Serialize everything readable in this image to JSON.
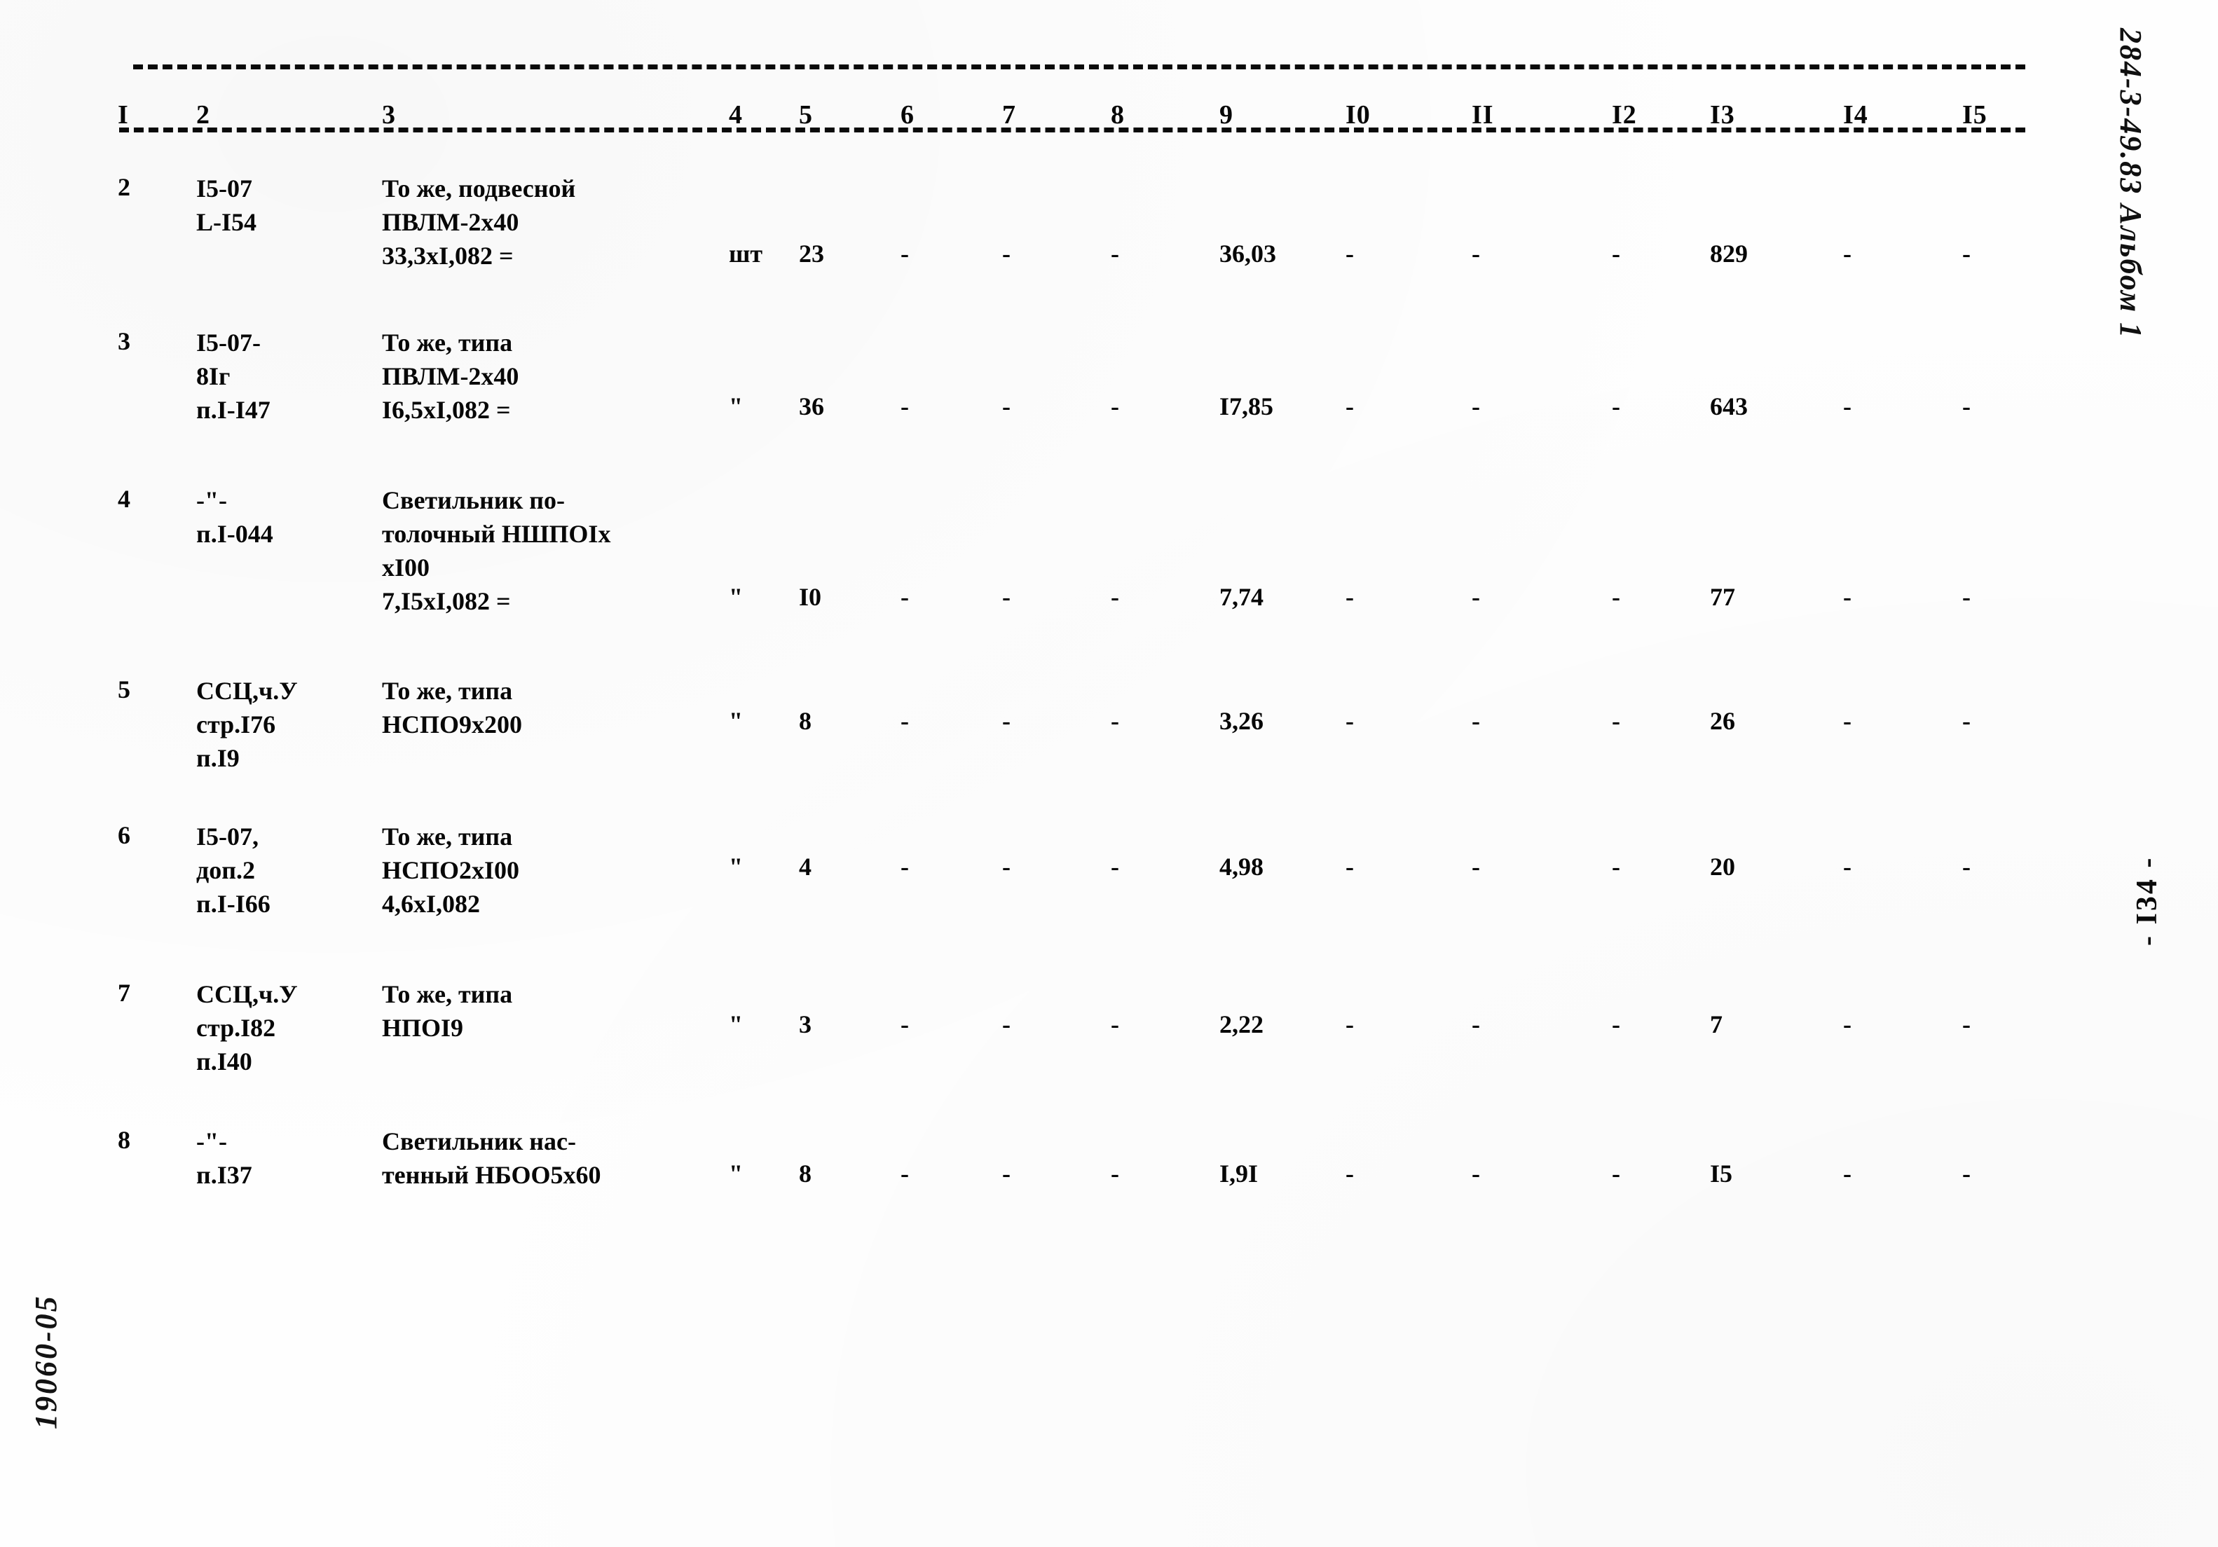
{
  "document": {
    "margin_code": "284-3-49.83 Альбом 1",
    "page_number": "- I34 -",
    "archive_stamp": "19060-05"
  },
  "table": {
    "column_headers": [
      "I",
      "2",
      "3",
      "4",
      "5",
      "6",
      "7",
      "8",
      "9",
      "I0",
      "II",
      "I2",
      "I3",
      "I4",
      "I5"
    ],
    "rows": [
      {
        "no": "2",
        "code": "I5-07\nL-I54",
        "name": "То же, подвесной\nПВЛМ-2х40\n33,3хI,082 =",
        "unit": "шт",
        "qty": "23",
        "c6": "-",
        "c7": "-",
        "c8": "-",
        "c9": "36,03",
        "c10": "-",
        "c11": "-",
        "c12": "-",
        "c13": "829",
        "c14": "-",
        "c15": "-"
      },
      {
        "no": "3",
        "code": "I5-07-\n8Iг\nп.I-I47",
        "name": "То же, типа\nПВЛМ-2х40\nI6,5хI,082 =",
        "unit": "\"",
        "qty": "36",
        "c6": "-",
        "c7": "-",
        "c8": "-",
        "c9": "I7,85",
        "c10": "-",
        "c11": "-",
        "c12": "-",
        "c13": "643",
        "c14": "-",
        "c15": "-"
      },
      {
        "no": "4",
        "code": "-\"-\nп.I-044",
        "name": "Светильник по-\nтолочный НШПОIх\nхI00\n7,I5хI,082 =",
        "unit": "\"",
        "qty": "I0",
        "c6": "-",
        "c7": "-",
        "c8": "-",
        "c9": "7,74",
        "c10": "-",
        "c11": "-",
        "c12": "-",
        "c13": "77",
        "c14": "-",
        "c15": "-"
      },
      {
        "no": "5",
        "code": "ССЦ,ч.У\nстр.I76\nп.I9",
        "name": "То же, типа\nНСПО9х200",
        "unit": "\"",
        "qty": "8",
        "c6": "-",
        "c7": "-",
        "c8": "-",
        "c9": "3,26",
        "c10": "-",
        "c11": "-",
        "c12": "-",
        "c13": "26",
        "c14": "-",
        "c15": "-"
      },
      {
        "no": "6",
        "code": "I5-07,\nдоп.2\nп.I-I66",
        "name": "То же, типа\nНСПО2хI00\n4,6хI,082",
        "unit": "\"",
        "qty": "4",
        "c6": "-",
        "c7": "-",
        "c8": "-",
        "c9": "4,98",
        "c10": "-",
        "c11": "-",
        "c12": "-",
        "c13": "20",
        "c14": "-",
        "c15": "-"
      },
      {
        "no": "7",
        "code": "ССЦ,ч.У\nстр.I82\nп.I40",
        "name": "То же, типа\nНПОI9",
        "unit": "\"",
        "qty": "3",
        "c6": "-",
        "c7": "-",
        "c8": "-",
        "c9": "2,22",
        "c10": "-",
        "c11": "-",
        "c12": "-",
        "c13": "7",
        "c14": "-",
        "c15": "-"
      },
      {
        "no": "8",
        "code": "-\"-\nп.I37",
        "name": "Светильник нас-\nтенный НБОО5х60",
        "unit": "\"",
        "qty": "8",
        "c6": "-",
        "c7": "-",
        "c8": "-",
        "c9": "I,9I",
        "c10": "-",
        "c11": "-",
        "c12": "-",
        "c13": "I5",
        "c14": "-",
        "c15": "-"
      }
    ]
  }
}
